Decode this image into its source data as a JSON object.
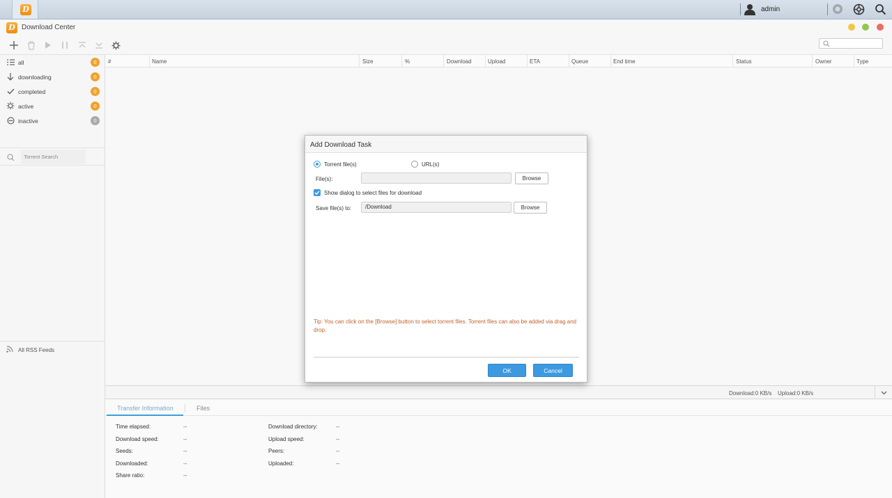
{
  "topbar": {
    "user_name": "admin"
  },
  "window": {
    "title": "Download Center",
    "colors": {
      "minimize": "#f1c644",
      "maximize": "#93c653",
      "close": "#ee6b66",
      "brand": "#f29a22",
      "accent": "#3d9ae0"
    }
  },
  "sidebar": {
    "items": [
      {
        "label": "all",
        "count": "0",
        "icon": "list-icon",
        "badge_color": "#f0a22c"
      },
      {
        "label": "downloading",
        "count": "0",
        "icon": "arrow-down-icon",
        "badge_color": "#f0a22c"
      },
      {
        "label": "completed",
        "count": "0",
        "icon": "check-icon",
        "badge_color": "#f0a22c"
      },
      {
        "label": "active",
        "count": "0",
        "icon": "gear-icon",
        "badge_color": "#f0a22c"
      },
      {
        "label": "inactive",
        "count": "0",
        "icon": "minus-circle-icon",
        "badge_color": "#a9a9a9"
      }
    ],
    "torrent_search_placeholder": "Torrent Search",
    "rss_label": "All RSS Feeds"
  },
  "table": {
    "columns": [
      "#",
      "Name",
      "Size",
      "%",
      "Download",
      "Upload",
      "ETA",
      "Queue",
      "End time",
      "Status",
      "Owner",
      "Type"
    ]
  },
  "status": {
    "download": "Download:0 KB/s",
    "upload": "Upload:0 KB/s"
  },
  "bottom": {
    "tabs": [
      "Transfer Information",
      "Files"
    ],
    "info": [
      {
        "label": "Time elapsed:",
        "value": "--"
      },
      {
        "label": "Download speed:",
        "value": "--"
      },
      {
        "label": "Seeds:",
        "value": "--"
      },
      {
        "label": "Downloaded:",
        "value": "--"
      },
      {
        "label": "Share ratio:",
        "value": "--"
      },
      {
        "label": "Download directory:",
        "value": "--"
      },
      {
        "label": "Upload speed:",
        "value": "--"
      },
      {
        "label": "Peers:",
        "value": "--"
      },
      {
        "label": "Uploaded:",
        "value": "--"
      }
    ]
  },
  "dialog": {
    "title": "Add Download Task",
    "radio_torrent": "Torrent file(s)",
    "radio_url": "URL(s)",
    "files_label": "File(s):",
    "files_value": "",
    "browse_label": "Browse",
    "show_dialog_label": "Show dialog to select files for download",
    "save_label": "Save file(s) to:",
    "save_value": "/Download",
    "tip": "Tip: You can click on the [Browse] button to select torrent files. Torrent files can also be added via drag and drop.",
    "ok_label": "OK",
    "cancel_label": "Cancel"
  }
}
